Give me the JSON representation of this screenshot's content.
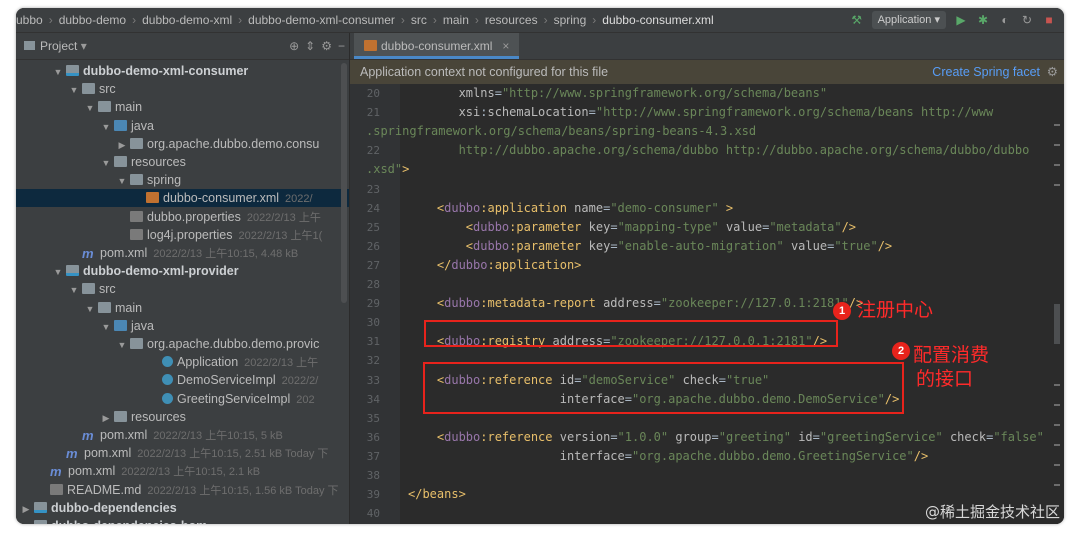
{
  "breadcrumb": [
    "ubbo",
    "dubbo-demo",
    "dubbo-demo-xml",
    "dubbo-demo-xml-consumer",
    "src",
    "main",
    "resources",
    "spring",
    "dubbo-consumer.xml"
  ],
  "toolbar": {
    "run_config": "Application"
  },
  "sidebar": {
    "title": "Project",
    "rows": [
      {
        "indent": 3,
        "arrow": "▼",
        "icon": "mod",
        "label": "dubbo-demo-xml-consumer",
        "bold": true,
        "meta": ""
      },
      {
        "indent": 4,
        "arrow": "▼",
        "icon": "folder",
        "label": "src",
        "meta": ""
      },
      {
        "indent": 5,
        "arrow": "▼",
        "icon": "folder",
        "label": "main",
        "meta": ""
      },
      {
        "indent": 6,
        "arrow": "▼",
        "icon": "blue",
        "label": "java",
        "meta": ""
      },
      {
        "indent": 7,
        "arrow": "▶",
        "icon": "folder",
        "label": "org.apache.dubbo.demo.consu",
        "meta": ""
      },
      {
        "indent": 6,
        "arrow": "▼",
        "icon": "folder",
        "label": "resources",
        "meta": ""
      },
      {
        "indent": 7,
        "arrow": "▼",
        "icon": "folder",
        "label": "spring",
        "meta": ""
      },
      {
        "indent": 8,
        "arrow": "",
        "icon": "xml",
        "label": "dubbo-consumer.xml",
        "meta": "2022/",
        "selected": true
      },
      {
        "indent": 7,
        "arrow": "",
        "icon": "prop",
        "label": "dubbo.properties",
        "meta": "2022/2/13 上午"
      },
      {
        "indent": 7,
        "arrow": "",
        "icon": "prop",
        "label": "log4j.properties",
        "meta": "2022/2/13 上午1("
      },
      {
        "indent": 4,
        "arrow": "",
        "icon": "mvn",
        "label": "pom.xml",
        "meta": "2022/2/13 上午10:15, 4.48 kB"
      },
      {
        "indent": 3,
        "arrow": "▼",
        "icon": "mod",
        "label": "dubbo-demo-xml-provider",
        "bold": true,
        "meta": ""
      },
      {
        "indent": 4,
        "arrow": "▼",
        "icon": "folder",
        "label": "src",
        "meta": ""
      },
      {
        "indent": 5,
        "arrow": "▼",
        "icon": "folder",
        "label": "main",
        "meta": ""
      },
      {
        "indent": 6,
        "arrow": "▼",
        "icon": "blue",
        "label": "java",
        "meta": ""
      },
      {
        "indent": 7,
        "arrow": "▼",
        "icon": "folder",
        "label": "org.apache.dubbo.demo.provic",
        "meta": ""
      },
      {
        "indent": 9,
        "arrow": "",
        "icon": "cls",
        "label": "Application",
        "meta": "2022/2/13 上午"
      },
      {
        "indent": 9,
        "arrow": "",
        "icon": "cls",
        "label": "DemoServiceImpl",
        "meta": "2022/2/"
      },
      {
        "indent": 9,
        "arrow": "",
        "icon": "cls",
        "label": "GreetingServiceImpl",
        "meta": "202"
      },
      {
        "indent": 6,
        "arrow": "▶",
        "icon": "folder",
        "label": "resources",
        "meta": ""
      },
      {
        "indent": 4,
        "arrow": "",
        "icon": "mvn",
        "label": "pom.xml",
        "meta": "2022/2/13 上午10:15, 5 kB"
      },
      {
        "indent": 3,
        "arrow": "",
        "icon": "mvn",
        "label": "pom.xml",
        "meta": "2022/2/13 上午10:15, 2.51 kB Today 下"
      },
      {
        "indent": 2,
        "arrow": "",
        "icon": "mvn",
        "label": "pom.xml",
        "meta": "2022/2/13 上午10:15, 2.1 kB"
      },
      {
        "indent": 2,
        "arrow": "",
        "icon": "prop",
        "label": "README.md",
        "meta": "2022/2/13 上午10:15, 1.56 kB Today 下"
      },
      {
        "indent": 1,
        "arrow": "▶",
        "icon": "mod",
        "label": "dubbo-dependencies",
        "bold": true,
        "meta": ""
      },
      {
        "indent": 1,
        "arrow": "▶",
        "icon": "mod",
        "label": "dubbo-dependencies-bom",
        "bold": true,
        "meta": ""
      }
    ]
  },
  "editor": {
    "tab": "dubbo-consumer.xml",
    "banner": "Application context not configured for this file",
    "banner_link": "Create Spring facet",
    "lines": [
      {
        "n": "20",
        "parts": [
          [
            "at",
            "       xmlns"
          ],
          [
            "p",
            "="
          ],
          [
            "st",
            "\"http://www.springframework.org/schema/beans\""
          ]
        ]
      },
      {
        "n": "21",
        "parts": [
          [
            "at",
            "       xsi"
          ],
          [
            "p",
            ":"
          ],
          [
            "at",
            "schemaLocation"
          ],
          [
            "p",
            "="
          ],
          [
            "st",
            "\"http://www.springframework.org/schema/beans http://www"
          ]
        ]
      },
      {
        "n": "",
        "parts": [
          [
            "st",
            ".springframework.org/schema/beans/spring-beans-4.3.xsd"
          ]
        ]
      },
      {
        "n": "22",
        "parts": [
          [
            "st",
            "       http://dubbo.apache.org/schema/dubbo http://dubbo.apache.org/schema/dubbo/dubbo"
          ]
        ]
      },
      {
        "n": "",
        "parts": [
          [
            "st",
            ".xsd\""
          ],
          [
            "tg",
            ">"
          ]
        ]
      },
      {
        "n": "23",
        "parts": []
      },
      {
        "n": "24",
        "parts": [
          [
            "tg",
            "    <"
          ],
          [
            "ns",
            "dubbo"
          ],
          [
            "tg",
            ":application "
          ],
          [
            "at",
            "name"
          ],
          [
            "p",
            "="
          ],
          [
            "st",
            "\"demo-consumer\""
          ],
          [
            "tg",
            " >"
          ]
        ]
      },
      {
        "n": "25",
        "parts": [
          [
            "tg",
            "        <"
          ],
          [
            "ns",
            "dubbo"
          ],
          [
            "tg",
            ":parameter "
          ],
          [
            "at",
            "key"
          ],
          [
            "p",
            "="
          ],
          [
            "st",
            "\"mapping-type\""
          ],
          [
            "at",
            " value"
          ],
          [
            "p",
            "="
          ],
          [
            "st",
            "\"metadata\""
          ],
          [
            "tg",
            "/>"
          ]
        ]
      },
      {
        "n": "26",
        "parts": [
          [
            "tg",
            "        <"
          ],
          [
            "ns",
            "dubbo"
          ],
          [
            "tg",
            ":parameter "
          ],
          [
            "at",
            "key"
          ],
          [
            "p",
            "="
          ],
          [
            "st",
            "\"enable-auto-migration\""
          ],
          [
            "at",
            " value"
          ],
          [
            "p",
            "="
          ],
          [
            "st",
            "\"true\""
          ],
          [
            "tg",
            "/>"
          ]
        ]
      },
      {
        "n": "27",
        "parts": [
          [
            "tg",
            "    </"
          ],
          [
            "ns",
            "dubbo"
          ],
          [
            "tg",
            ":application>"
          ]
        ]
      },
      {
        "n": "28",
        "parts": []
      },
      {
        "n": "29",
        "parts": [
          [
            "tg",
            "    <"
          ],
          [
            "ns",
            "dubbo"
          ],
          [
            "tg",
            ":metadata-report "
          ],
          [
            "at",
            "address"
          ],
          [
            "p",
            "="
          ],
          [
            "st",
            "\"zookeeper://127.0.1:2181\""
          ],
          [
            "tg",
            "/>"
          ]
        ]
      },
      {
        "n": "30",
        "parts": []
      },
      {
        "n": "31",
        "parts": [
          [
            "tg",
            "    <"
          ],
          [
            "ns",
            "dubbo"
          ],
          [
            "tg",
            ":registry "
          ],
          [
            "at",
            "address"
          ],
          [
            "p",
            "="
          ],
          [
            "st",
            "\"zookeeper://127.0.0.1:2181\""
          ],
          [
            "tg",
            "/>"
          ]
        ]
      },
      {
        "n": "32",
        "parts": []
      },
      {
        "n": "33",
        "parts": [
          [
            "tg",
            "    <"
          ],
          [
            "ns",
            "dubbo"
          ],
          [
            "tg",
            ":reference "
          ],
          [
            "at",
            "id"
          ],
          [
            "p",
            "="
          ],
          [
            "st",
            "\"demoService\""
          ],
          [
            "at",
            " check"
          ],
          [
            "p",
            "="
          ],
          [
            "st",
            "\"true\""
          ]
        ]
      },
      {
        "n": "34",
        "parts": [
          [
            "at",
            "                     interface"
          ],
          [
            "p",
            "="
          ],
          [
            "st",
            "\"org.apache.dubbo.demo.DemoService\""
          ],
          [
            "tg",
            "/>"
          ]
        ]
      },
      {
        "n": "35",
        "parts": []
      },
      {
        "n": "36",
        "parts": [
          [
            "tg",
            "    <"
          ],
          [
            "ns",
            "dubbo"
          ],
          [
            "tg",
            ":reference "
          ],
          [
            "at",
            "version"
          ],
          [
            "p",
            "="
          ],
          [
            "st",
            "\"1.0.0\""
          ],
          [
            "at",
            " group"
          ],
          [
            "p",
            "="
          ],
          [
            "st",
            "\"greeting\""
          ],
          [
            "at",
            " id"
          ],
          [
            "p",
            "="
          ],
          [
            "st",
            "\"greetingService\""
          ],
          [
            "at",
            " check"
          ],
          [
            "p",
            "="
          ],
          [
            "st",
            "\"false\""
          ]
        ]
      },
      {
        "n": "37",
        "parts": [
          [
            "at",
            "                     interface"
          ],
          [
            "p",
            "="
          ],
          [
            "st",
            "\"org.apache.dubbo.demo.GreetingService\""
          ],
          [
            "tg",
            "/>"
          ]
        ]
      },
      {
        "n": "38",
        "parts": []
      },
      {
        "n": "39",
        "parts": [
          [
            "tg",
            "</beans>"
          ]
        ]
      },
      {
        "n": "40",
        "parts": []
      }
    ]
  },
  "annotations": {
    "badge1": "1",
    "label1": "注册中心",
    "badge2": "2",
    "label2_line1": "配置消费",
    "label2_line2": "的接口"
  },
  "watermark": "@稀土掘金技术社区"
}
